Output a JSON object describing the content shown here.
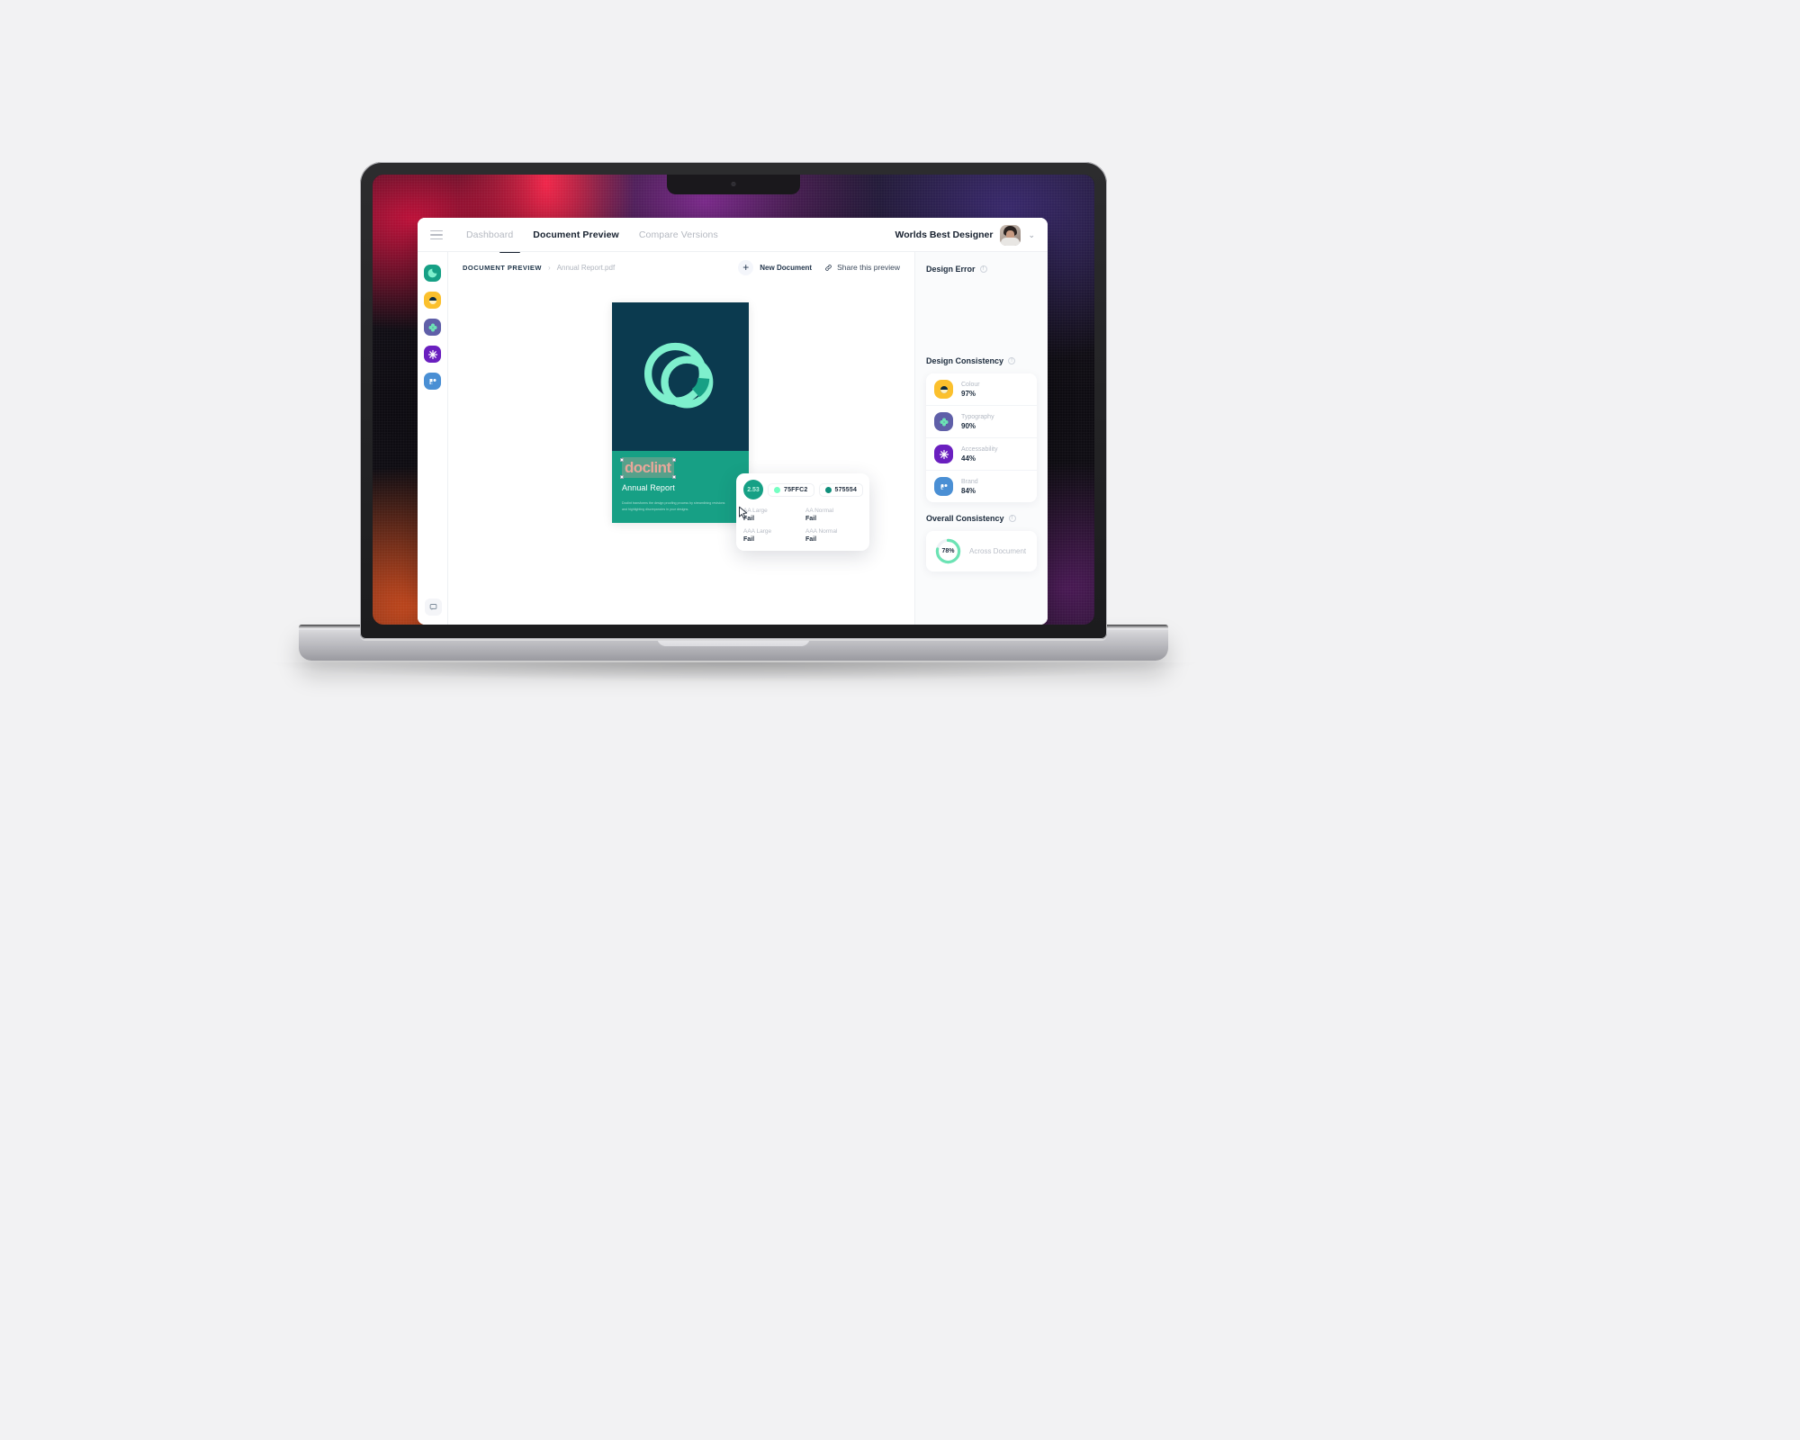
{
  "topbar": {
    "menu_icon": "hamburger-icon",
    "tabs": [
      {
        "label": "Dashboard",
        "active": false
      },
      {
        "label": "Document Preview",
        "active": true
      },
      {
        "label": "Compare Versions",
        "active": false
      }
    ],
    "user_name": "Worlds Best Designer",
    "chevron": "⌄"
  },
  "rail": {
    "items": [
      {
        "name": "doclint-logo-icon",
        "color": "#16a085"
      },
      {
        "name": "colour-icon",
        "color": "#fbc02d"
      },
      {
        "name": "typography-icon",
        "color": "#5f5fa8"
      },
      {
        "name": "accessibility-icon",
        "color": "#6a1fbf"
      },
      {
        "name": "brand-icon",
        "color": "#4a8fd4"
      }
    ],
    "chat_icon": "chat-bubble-icon"
  },
  "subbar": {
    "breadcrumb_root": "DOCUMENT PREVIEW",
    "breadcrumb_sep": "›",
    "breadcrumb_file": "Annual Report.pdf",
    "new_document_label": "New Document",
    "plus_icon": "+",
    "share_label": "Share this preview",
    "link_icon": "link-icon"
  },
  "document": {
    "logo_icon": "doclint-circles-logo",
    "brand_text": "doclint",
    "title": "Annual Report",
    "body": "Doclint transforms the design proofing process by streamlining revisions and highlighting discrepancies in your designs.",
    "bg_top": "#0b3a4f",
    "bg_bottom": "#17a085"
  },
  "contrast_popup": {
    "ratio": "2.53",
    "foreground_hex": "75FFC2",
    "background_hex": "575554",
    "foreground_color": "#75ffc2",
    "background_color": "#0f8f7b",
    "checks": [
      {
        "label": "AA Large",
        "value": "Fail"
      },
      {
        "label": "AA Normal",
        "value": "Fail"
      },
      {
        "label": "AAA Large",
        "value": "Fail"
      },
      {
        "label": "AAA Normal",
        "value": "Fail"
      }
    ]
  },
  "right_panel": {
    "design_error_title": "Design Error",
    "design_consistency_title": "Design Consistency",
    "consistency_items": [
      {
        "label": "Colour",
        "value": "97%",
        "icon": "colour-icon",
        "color": "#fbc02d"
      },
      {
        "label": "Typography",
        "value": "90%",
        "icon": "typography-icon",
        "color": "#5f5fa8"
      },
      {
        "label": "Accessability",
        "value": "44%",
        "icon": "accessibility-icon",
        "color": "#6a1fbf"
      },
      {
        "label": "Brand",
        "value": "84%",
        "icon": "brand-icon",
        "color": "#4a8fd4"
      }
    ],
    "overall_title": "Overall Consistency",
    "overall_value": "78%",
    "overall_label": "Across Document",
    "overall_ring_color": "#6ce3b4",
    "info_icon": "!"
  }
}
